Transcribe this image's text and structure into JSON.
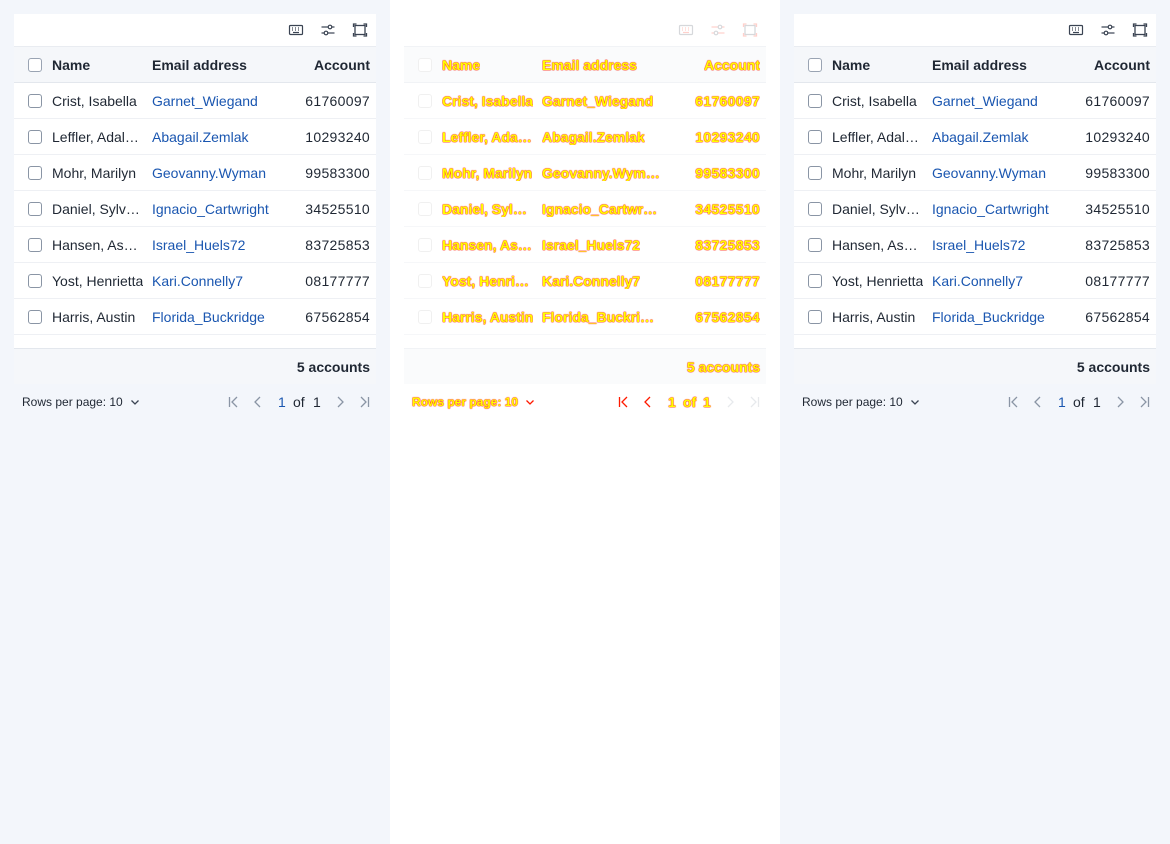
{
  "toolbar": {
    "icons": [
      "keyboard-icon",
      "filter-settings-icon",
      "fullscreen-icon"
    ]
  },
  "columns": {
    "select": "",
    "name": "Name",
    "email": "Email address",
    "account": "Account"
  },
  "rows": [
    {
      "name": "Crist, Isabella",
      "email": "Garnet_Wiegand",
      "account": "61760097"
    },
    {
      "name": "Leffler, Adalberto",
      "email": "Abagail.Zemlak",
      "account": "10293240"
    },
    {
      "name": "Mohr, Marilyn",
      "email": "Geovanny.Wyman",
      "account": "99583300"
    },
    {
      "name": "Daniel, Sylvester",
      "email": "Ignacio_Cartwright",
      "account": "34525510"
    },
    {
      "name": "Hansen, Ashley",
      "email": "Israel_Huels72",
      "account": "83725853"
    },
    {
      "name": "Yost, Henrietta",
      "email": "Kari.Connelly7",
      "account": "08177777"
    },
    {
      "name": "Harris, Austin",
      "email": "Florida_Buckridge",
      "account": "67562854"
    }
  ],
  "footer": {
    "count_label": "5 accounts"
  },
  "pagination": {
    "rows_per_page_label": "Rows per page: 10",
    "current_page": "1",
    "of_label": "of",
    "total_pages": "1"
  },
  "colors": {
    "link": "#1a56b0",
    "highlight_fill": "#ffff00",
    "highlight_outline": "#ff1a00",
    "background": "#eef2f8"
  }
}
